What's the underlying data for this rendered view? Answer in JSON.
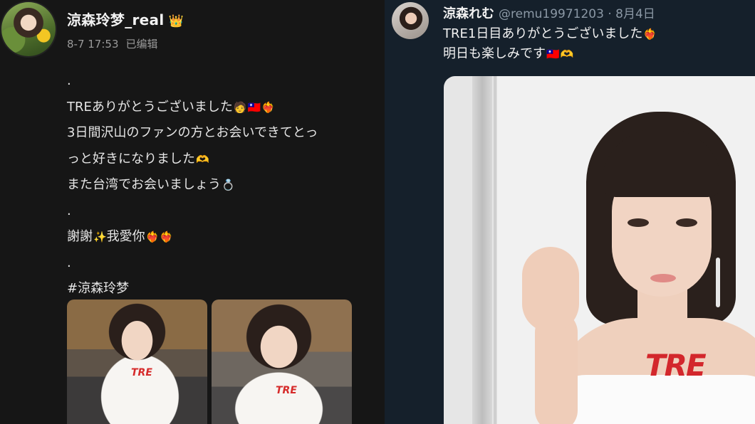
{
  "left_post": {
    "username": "涼森玲梦_real",
    "crown_icon": "👑",
    "timestamp": "8-7 17:53",
    "edited": "已编辑",
    "lines": [
      {
        "text": "."
      },
      {
        "text": "TREありがとうございました",
        "emoji": [
          "🧑",
          "🇹🇼",
          "❤️‍🔥"
        ]
      },
      {
        "text": "3日間沢山のファンの方とお会いできてとっ"
      },
      {
        "text": "っと好きになりました",
        "emoji": [
          "🫶"
        ]
      },
      {
        "text": "また台湾でお会いましょう",
        "emoji": [
          "💍"
        ]
      },
      {
        "text": "."
      },
      {
        "text": "謝謝",
        "mid_emoji": "✨",
        "text2": "我愛你",
        "emoji": [
          "❤️‍🔥",
          "❤️‍🔥"
        ]
      },
      {
        "text": "."
      },
      {
        "text": "#涼森玲梦"
      }
    ],
    "thumb_logo": "TRE"
  },
  "right_post": {
    "display_name": "涼森れむ",
    "handle": "@remu19971203",
    "separator": "·",
    "date": "8月4日",
    "lines": [
      {
        "text": "TRE1日目ありがとうございました",
        "emoji": [
          "❤️‍🔥"
        ]
      },
      {
        "text": "明日も楽しみです",
        "emoji": [
          "🇹🇼",
          "🫶"
        ]
      }
    ],
    "photo_logo": "TRE"
  },
  "colors": {
    "left_bg": "#161616",
    "right_bg": "#15202b",
    "text_primary": "#f2f2f2",
    "text_secondary": "#9a9a9a",
    "logo_red": "#d3272c"
  }
}
